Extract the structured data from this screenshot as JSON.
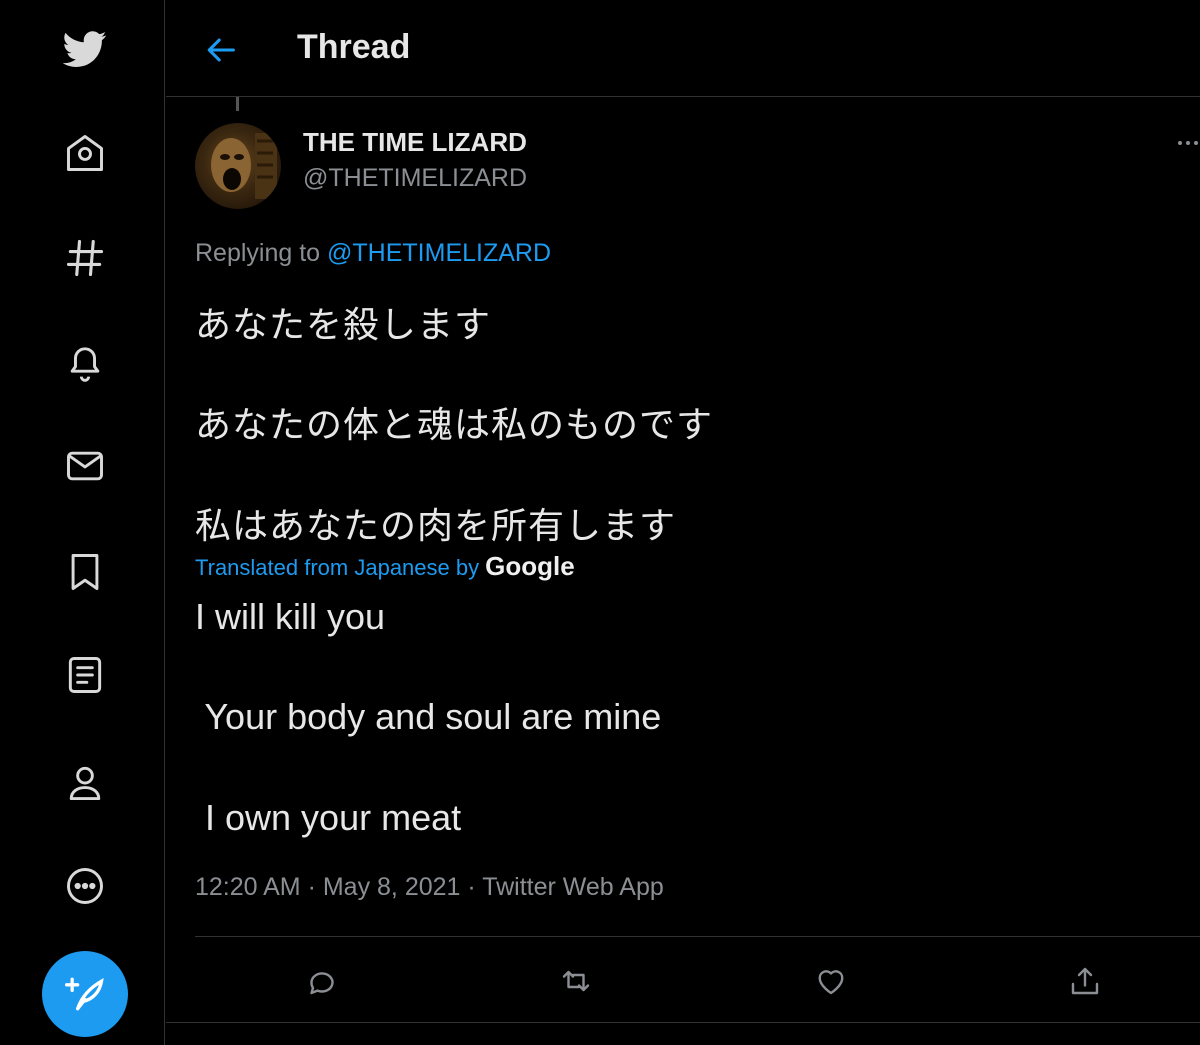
{
  "sidebar": {
    "items": [
      {
        "icon": "twitter-bird-icon"
      },
      {
        "icon": "home-icon"
      },
      {
        "icon": "hashtag-icon"
      },
      {
        "icon": "bell-icon"
      },
      {
        "icon": "mail-icon"
      },
      {
        "icon": "bookmark-icon"
      },
      {
        "icon": "list-icon"
      },
      {
        "icon": "profile-icon"
      },
      {
        "icon": "more-circle-icon"
      }
    ],
    "compose_icon": "compose-feather-icon",
    "colors": {
      "brand": "#1d9bf0",
      "icon": "#d9d9d9"
    }
  },
  "header": {
    "back_icon": "back-arrow-icon",
    "title": "Thread"
  },
  "tweet": {
    "author": {
      "display_name": "THE TIME LIZARD",
      "handle": "@THETIMELIZARD"
    },
    "replying_prefix": "Replying to",
    "replying_to": "@THETIMELIZARD",
    "original_lines": [
      "あなたを殺します",
      "あなたの体と魂は私のものです",
      "私はあなたの肉を所有します"
    ],
    "translation_label": "Translated from Japanese by",
    "translation_provider": "Google",
    "translated_lines": [
      "I will kill you",
      " Your body and soul are mine",
      " I own your meat"
    ],
    "meta": "12:20 AM · May 8, 2021 · Twitter Web App"
  },
  "actions": [
    {
      "icon": "reply-icon"
    },
    {
      "icon": "retweet-icon"
    },
    {
      "icon": "like-heart-icon"
    },
    {
      "icon": "share-icon"
    }
  ]
}
